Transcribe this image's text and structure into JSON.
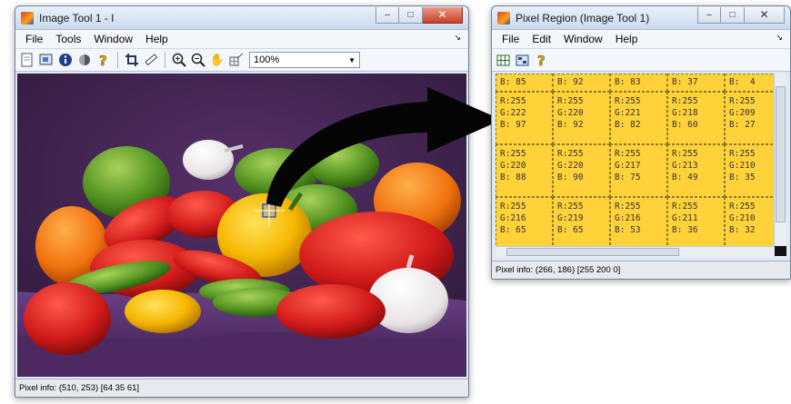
{
  "image_tool": {
    "title": "Image Tool 1 - I",
    "menu": [
      "File",
      "Tools",
      "Window",
      "Help"
    ],
    "zoom": "100%",
    "status": "Pixel info: (510, 253)  [64 35 61]"
  },
  "pixel_region": {
    "title": "Pixel Region (Image Tool 1)",
    "menu": [
      "File",
      "Edit",
      "Window",
      "Help"
    ],
    "status": "Pixel info: (266, 186)  [255 200 0]",
    "highlight_color": "#ffd23a",
    "top_partial_row": [
      "B: 85",
      "B: 92",
      "B: 83",
      "B: 37",
      "B:  4"
    ],
    "rows": [
      [
        {
          "r": "R:255",
          "g": "G:222",
          "b": "B: 97"
        },
        {
          "r": "R:255",
          "g": "G:220",
          "b": "B: 92"
        },
        {
          "r": "R:255",
          "g": "G:221",
          "b": "B: 82"
        },
        {
          "r": "R:255",
          "g": "G:218",
          "b": "B: 60"
        },
        {
          "r": "R:255",
          "g": "G:209",
          "b": "B: 27"
        }
      ],
      [
        {
          "r": "R:255",
          "g": "G:220",
          "b": "B: 88"
        },
        {
          "r": "R:255",
          "g": "G:220",
          "b": "B: 90"
        },
        {
          "r": "R:255",
          "g": "G:217",
          "b": "B: 75"
        },
        {
          "r": "R:255",
          "g": "G:213",
          "b": "B: 49"
        },
        {
          "r": "R:255",
          "g": "G:210",
          "b": "B: 35"
        }
      ],
      [
        {
          "r": "R:255",
          "g": "G:216",
          "b": "B: 65"
        },
        {
          "r": "R:255",
          "g": "G:219",
          "b": "B: 65"
        },
        {
          "r": "R:255",
          "g": "G:216",
          "b": "B: 53"
        },
        {
          "r": "R:255",
          "g": "G:211",
          "b": "B: 36"
        },
        {
          "r": "R:255",
          "g": "G:210",
          "b": "B: 32"
        }
      ]
    ]
  }
}
